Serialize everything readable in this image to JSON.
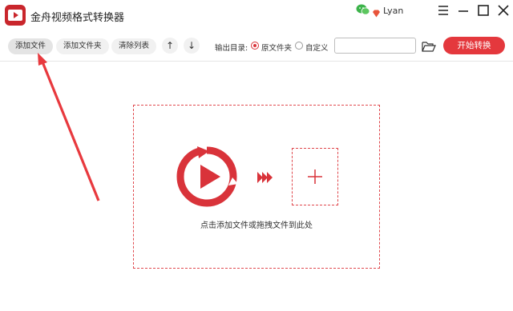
{
  "app": {
    "title": "金舟视频格式转换器",
    "user_name": "Lyan",
    "brand_color": "#e4383d"
  },
  "window_controls": {
    "menu_icon": "hamburger-menu-icon",
    "minimize_icon": "minimize-icon",
    "maximize_icon": "maximize-icon",
    "close_icon": "close-icon"
  },
  "toolbar": {
    "add_file": "添加文件",
    "add_folder": "添加文件夹",
    "clear_list": "清除列表",
    "move_up": "↑",
    "move_down": "↓",
    "output_label": "输出目录:",
    "option_original": "原文件夹",
    "option_custom": "自定义",
    "selected_option": "原文件夹",
    "path_value": "",
    "start_button": "开始转换"
  },
  "drop_zone": {
    "hint": "点击添加文件或拖拽文件到此处",
    "add_icon": "plus-icon"
  }
}
